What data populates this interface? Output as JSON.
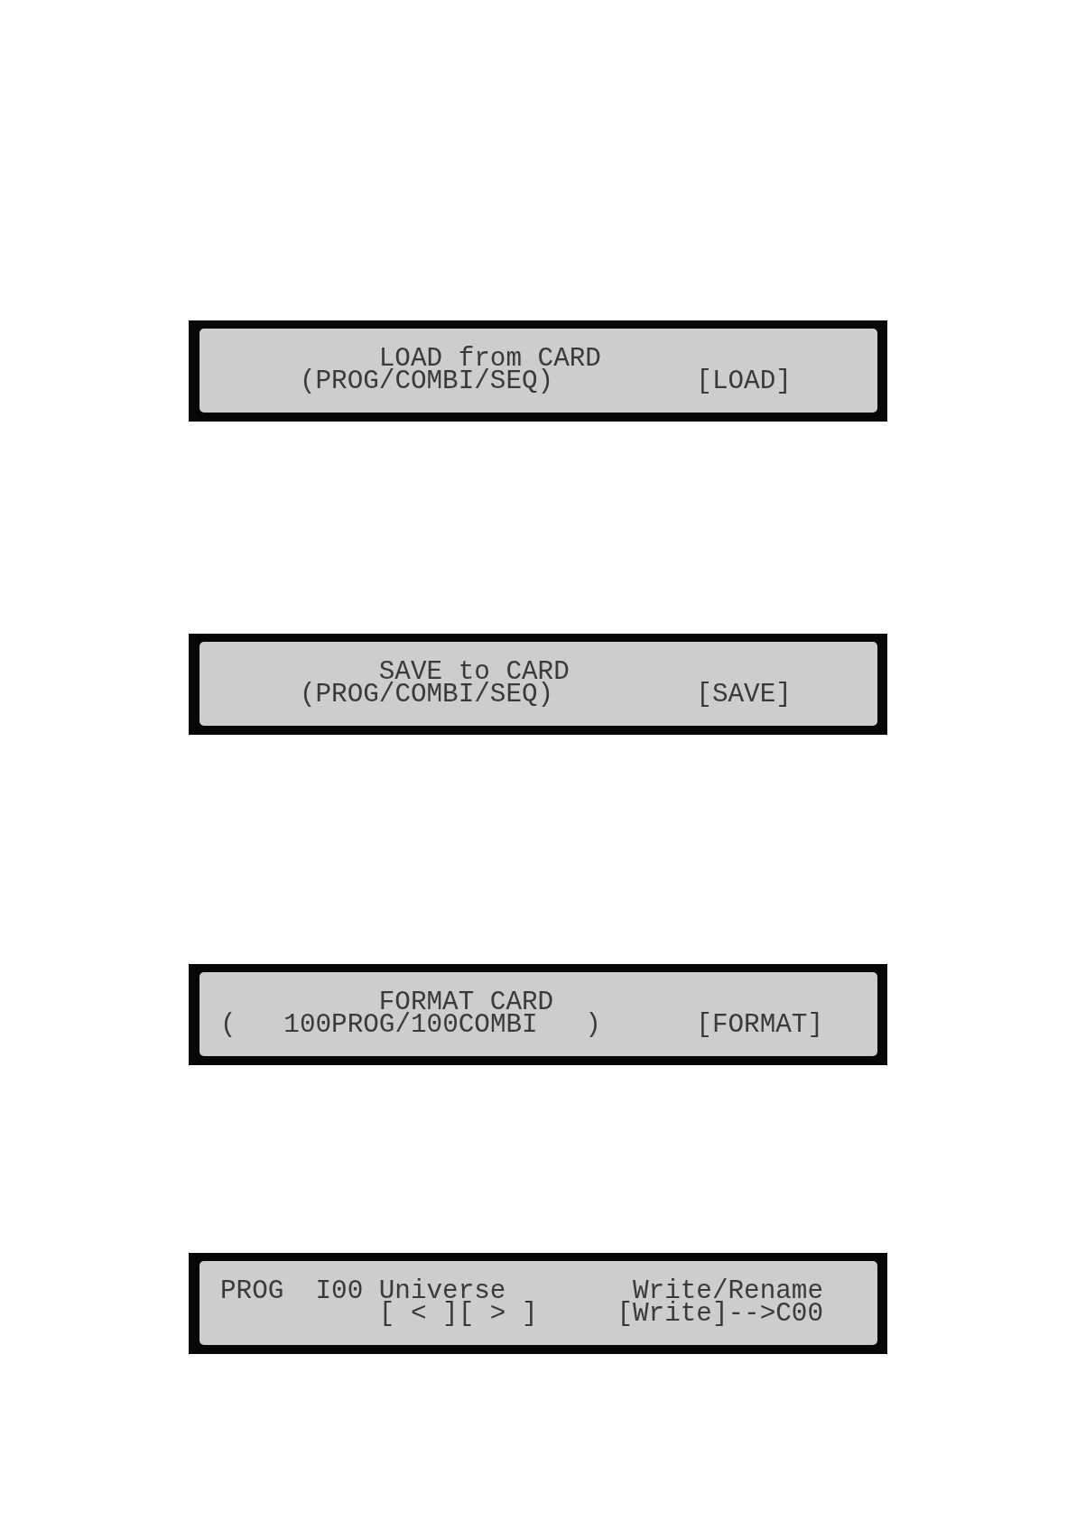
{
  "displays": [
    {
      "kind": "card_menu",
      "title": "LOAD from CARD",
      "option": "(PROG/COMBI/SEQ)",
      "softkey": "[LOAD]"
    },
    {
      "kind": "card_menu",
      "title": "SAVE to CARD",
      "option": "(PROG/COMBI/SEQ)",
      "softkey": "[SAVE]"
    },
    {
      "kind": "card_menu",
      "title": "FORMAT CARD",
      "option": "(   100PROG/100COMBI   )",
      "softkey": "[FORMAT]"
    },
    {
      "kind": "write_rename",
      "mode": "PROG",
      "program_number": "I00",
      "program_name": "Universe",
      "page_title": "Write/Rename",
      "cursor_keys": [
        "[ < ]",
        "[ > ]"
      ],
      "softkey": "[Write]",
      "destination": "-->C00"
    }
  ]
}
